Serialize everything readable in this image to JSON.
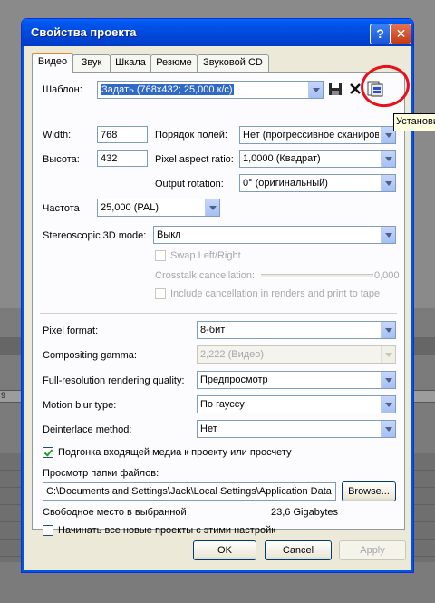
{
  "background": {
    "ruler_mark": "9"
  },
  "window": {
    "title": "Свойства проекта",
    "help_glyph": "?",
    "close_glyph": "✕"
  },
  "tabs": [
    "Видео",
    "Звук",
    "Шкала",
    "Резюме",
    "Звуковой CD"
  ],
  "template": {
    "label": "Шаблон:",
    "value": "Задать (768x432; 25,000 к/с)",
    "icons": [
      "save-icon",
      "delete-icon",
      "match-media-icon"
    ]
  },
  "tooltip": "Установи",
  "width": {
    "label": "Width:",
    "value": "768"
  },
  "height": {
    "label": "Высота:",
    "value": "432"
  },
  "field_order": {
    "label": "Порядок полей:",
    "value": "Нет (прогрессивное сканирование)"
  },
  "pixel_aspect": {
    "label": "Pixel aspect ratio:",
    "value": "1,0000 (Квадрат)"
  },
  "output_rotation": {
    "label": "Output rotation:",
    "value": "0° (оригинальный)"
  },
  "frame_rate": {
    "label": "Частота",
    "value": "25,000 (PAL)"
  },
  "stereo3d": {
    "label": "Stereoscopic 3D mode:",
    "value": "Выкл"
  },
  "swap": {
    "label": "Swap Left/Right"
  },
  "crosstalk": {
    "label": "Crosstalk cancellation:",
    "value": "0,000"
  },
  "include_cancel": {
    "label": "Include cancellation in renders and print to tape"
  },
  "pixel_format": {
    "label": "Pixel format:",
    "value": "8-бит"
  },
  "compositing_gamma": {
    "label": "Compositing gamma:",
    "value": "2,222 (Видео)"
  },
  "full_res_quality": {
    "label": "Full-resolution rendering quality:",
    "value": "Предпросмотр"
  },
  "motion_blur": {
    "label": "Motion blur type:",
    "value": "По гауссу"
  },
  "deinterlace": {
    "label": "Deinterlace method:",
    "value": "Нет"
  },
  "adjust_media": {
    "label": "Подгонка входящей медиа к проекту или просчету",
    "checked": true
  },
  "prerender": {
    "label": "Просмотр папки файлов:",
    "value": "C:\\Documents and Settings\\Jack\\Local Settings\\Application Data",
    "browse": "Browse..."
  },
  "free_space": {
    "label": "Свободное место в выбранной",
    "value": "23,6 Gigabytes"
  },
  "start_new": {
    "label": "Начинать все новые проекты с этими настройками",
    "checked": false
  },
  "buttons": {
    "ok": "OK",
    "cancel": "Cancel",
    "apply": "Apply"
  },
  "colors": {
    "title_bar": "#0054e3",
    "panel": "#fcfcfe",
    "dialog": "#ece9d8",
    "highlight": "#316ac5",
    "annotation": "#e8101a"
  }
}
